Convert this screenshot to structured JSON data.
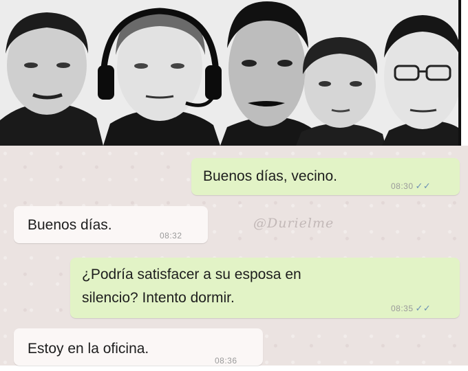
{
  "messages": [
    {
      "text": "Buenos días, vecino.",
      "time": "08:30",
      "ticks": "✓✓"
    },
    {
      "text": "Buenos días.",
      "time": "08:32"
    },
    {
      "text_line1": "¿Podría satisfacer a su esposa en",
      "text_line2": "silencio? Intento dormir.",
      "time": "08:35",
      "ticks": "✓✓"
    },
    {
      "text": "Estoy en la oficina.",
      "time": "08:36"
    }
  ],
  "watermark": "@Durielme"
}
